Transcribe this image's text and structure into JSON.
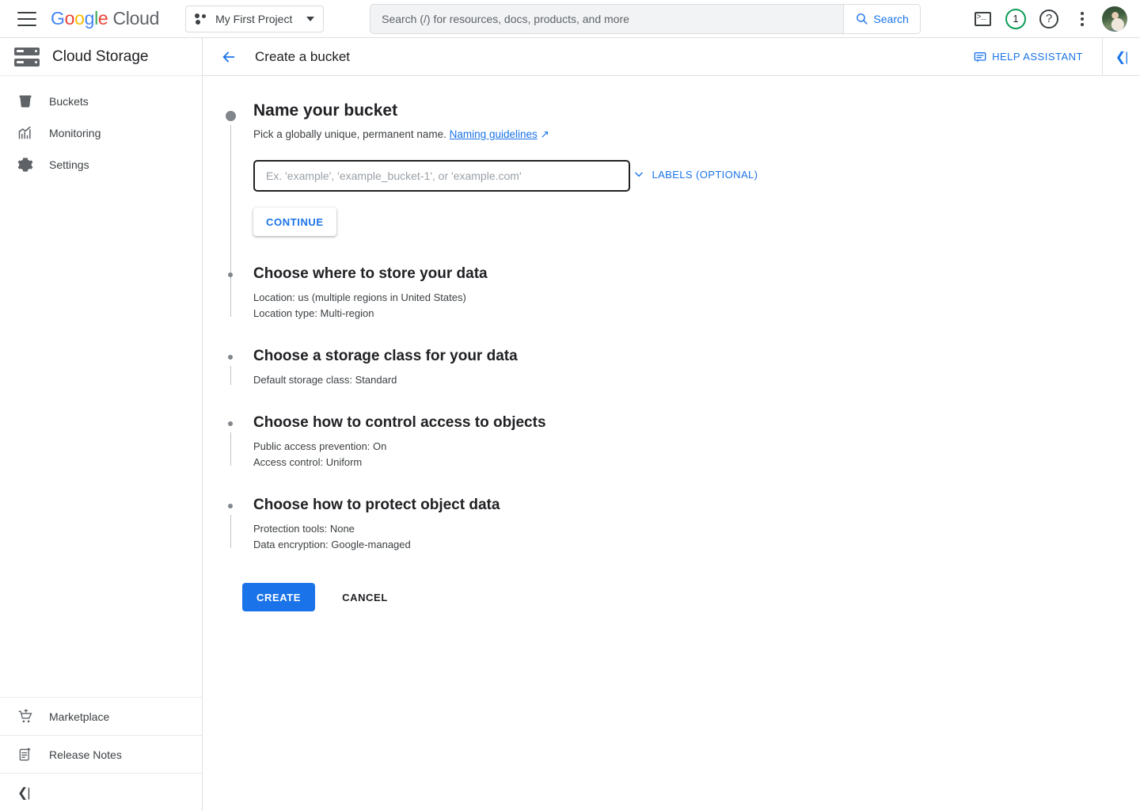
{
  "topbar": {
    "menu_icon": "hamburger-menu-icon",
    "logo": {
      "google": "Google",
      "cloud": "Cloud"
    },
    "project": {
      "label": "My First Project",
      "icon": "project-dots-icon",
      "caret": "chevron-down-icon"
    },
    "search": {
      "placeholder": "Search (/) for resources, docs, products, and more",
      "value": "",
      "button_label": "Search",
      "icon": "search-icon"
    },
    "icons": {
      "terminal": "cloud-shell-terminal-icon",
      "notifications_count": "1",
      "help": "?",
      "more": "more-options-icon",
      "avatar": "user-avatar"
    },
    "colors": {
      "accent_blue": "#1a73e8",
      "badge_green": "#0f9d58"
    }
  },
  "sidebar": {
    "product_title": "Cloud Storage",
    "product_icon": "cloud-storage-icon",
    "items": [
      {
        "label": "Buckets",
        "icon": "bucket-icon"
      },
      {
        "label": "Monitoring",
        "icon": "monitoring-chart-icon"
      },
      {
        "label": "Settings",
        "icon": "gear-icon"
      }
    ],
    "bottom_items": [
      {
        "label": "Marketplace",
        "icon": "shopping-cart-icon"
      },
      {
        "label": "Release Notes",
        "icon": "release-notes-icon"
      }
    ],
    "collapse_icon": "collapse-panel-icon"
  },
  "page_header": {
    "back_icon": "back-arrow-icon",
    "title": "Create a bucket",
    "help_assistant": {
      "label": "HELP ASSISTANT",
      "icon": "help-assistant-chat-icon"
    },
    "rail_collapse_icon": "collapse-right-panel-icon"
  },
  "form": {
    "step1": {
      "heading": "Name your bucket",
      "description_prefix": "Pick a globally unique, permanent name.",
      "link_label": "Naming guidelines",
      "link_icon": "external-link-icon",
      "input_placeholder": "Ex. 'example', 'example_bucket-1', or 'example.com'",
      "input_value": "",
      "labels_toggle": "LABELS (OPTIONAL)",
      "labels_toggle_icon": "chevron-down-icon",
      "continue_label": "CONTINUE"
    },
    "step2": {
      "heading": "Choose where to store your data",
      "summary": [
        "Location: us (multiple regions in United States)",
        "Location type: Multi-region"
      ]
    },
    "step3": {
      "heading": "Choose a storage class for your data",
      "summary": [
        "Default storage class: Standard"
      ]
    },
    "step4": {
      "heading": "Choose how to control access to objects",
      "summary": [
        "Public access prevention: On",
        "Access control: Uniform"
      ]
    },
    "step5": {
      "heading": "Choose how to protect object data",
      "summary": [
        "Protection tools: None",
        "Data encryption: Google-managed"
      ]
    },
    "actions": {
      "create_label": "CREATE",
      "cancel_label": "CANCEL"
    }
  }
}
